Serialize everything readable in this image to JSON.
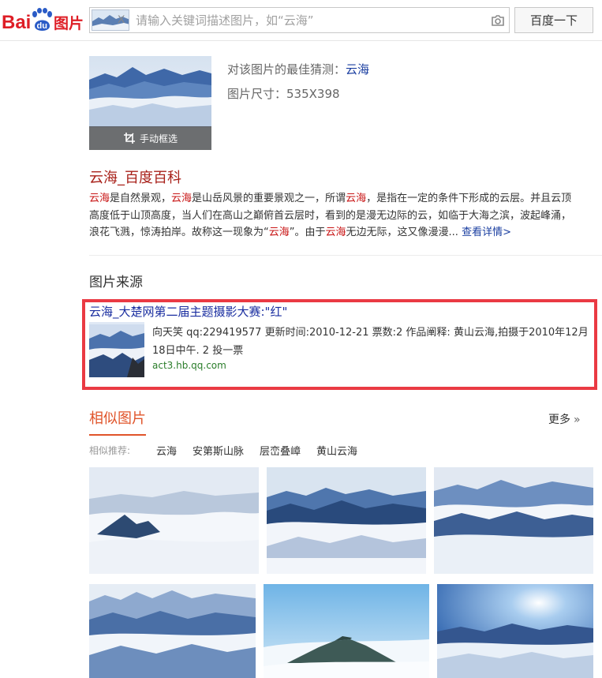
{
  "header": {
    "logo_text": "Bai du 图片",
    "logo_prefix": "Bai",
    "logo_du": "du",
    "logo_suffix": "图片",
    "search_thumb_close": "X",
    "search_placeholder": "请输入关键词描述图片，如“云海”",
    "search_button": "百度一下"
  },
  "result": {
    "crop_label": "手动框选",
    "guess_label": "对该图片的最佳猜测：",
    "guess_value": "云海",
    "size_text": "图片尺寸：535X398"
  },
  "baike": {
    "title": "云海_百度百科",
    "line1": [
      {
        "t": "云海",
        "hl": true
      },
      {
        "t": "是自然景观，",
        "hl": false
      },
      {
        "t": "云海",
        "hl": true
      },
      {
        "t": "是山岳风景的重要景观之一，所谓",
        "hl": false
      },
      {
        "t": "云海",
        "hl": true
      },
      {
        "t": "，是指在一定的条件下形成的云层。并且云顶",
        "hl": false
      }
    ],
    "line2": "高度低于山顶高度，当人们在高山之巅俯首云层时，看到的是漫无边际的云，如临于大海之滨，波起峰涌，",
    "line3": [
      {
        "t": "浪花飞溅，惊涛拍岸。故称这一现象为“",
        "hl": false
      },
      {
        "t": "云海",
        "hl": true
      },
      {
        "t": "”。由于",
        "hl": false
      },
      {
        "t": "云海",
        "hl": true
      },
      {
        "t": "无边无际，这又像漫漫... ",
        "hl": false
      }
    ],
    "details_link": "查看详情>"
  },
  "source": {
    "section_title": "图片来源",
    "title": "云海_大楚网第二届主题摄影大赛:\"红\"",
    "desc_line1": "向天笑 qq:229419577 更新时间:2010-12-21 票数:2 作品阐释: 黄山云海,拍摄于2010年12月",
    "desc_line2": "18日中午. 2 投一票",
    "url": "act3.hb.qq.com"
  },
  "similar": {
    "tab_label": "相似图片",
    "more_label": "更多",
    "more_chevron": "»",
    "rec_label": "相似推荐:",
    "tags": [
      "云海",
      "安第斯山脉",
      "层峦叠嶂",
      "黄山云海"
    ]
  }
}
